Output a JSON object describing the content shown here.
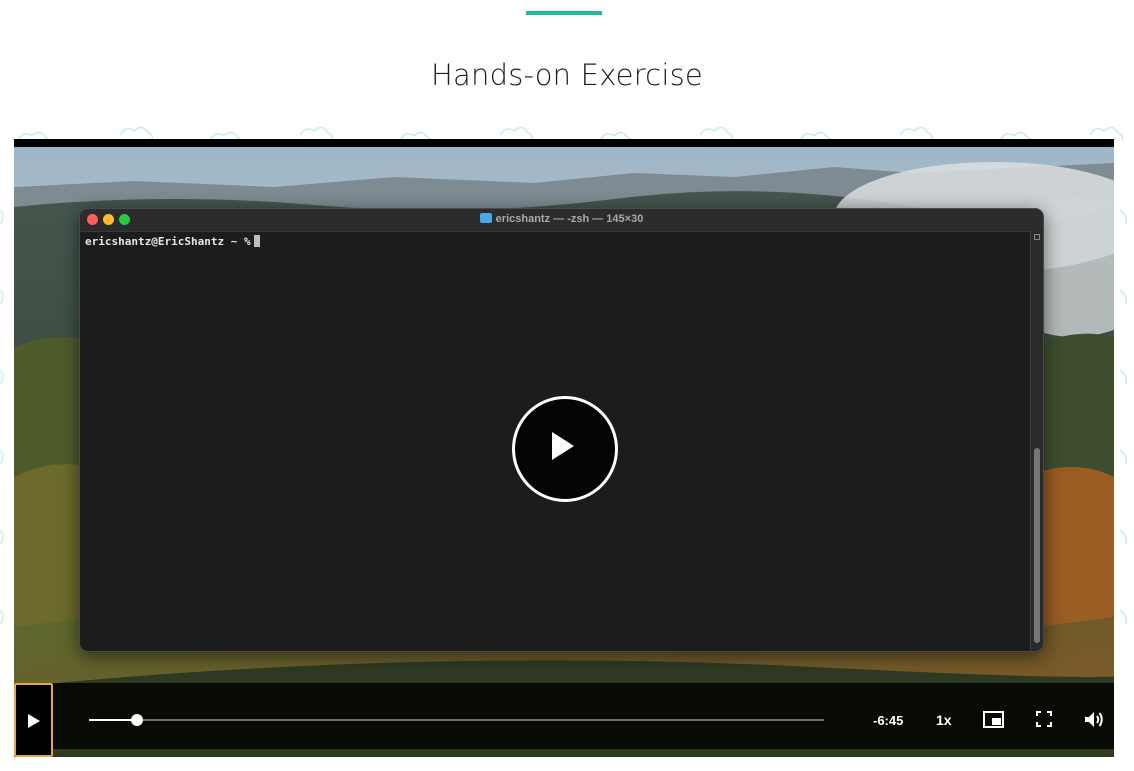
{
  "page": {
    "section_title": "Hands-on Exercise",
    "accent_color": "#1fb99a"
  },
  "terminal": {
    "title": "ericshantz — -zsh — 145×30",
    "prompt": "ericshantz@EricShantz ~ %"
  },
  "player": {
    "big_play_icon": "play-icon",
    "time_remaining": "-6:45",
    "playback_speed": "1x",
    "progress_fraction": 0.065,
    "play_button_focus_color": "#e7a54a",
    "icons": [
      "play-icon",
      "picture-in-picture-icon",
      "fullscreen-icon",
      "volume-icon"
    ]
  }
}
